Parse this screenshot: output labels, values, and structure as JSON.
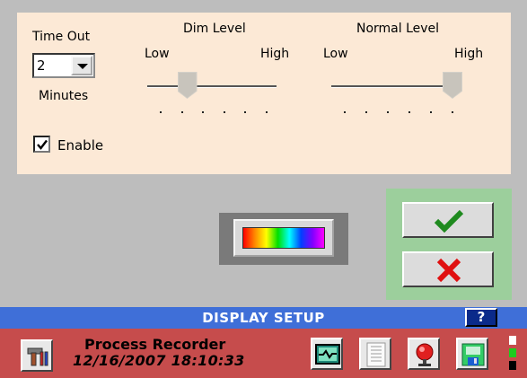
{
  "settings": {
    "timeout_label": "Time Out",
    "timeout_value": "2",
    "minutes_label": "Minutes",
    "enable_label": "Enable",
    "enable_checked": true,
    "dim_level": {
      "title": "Dim Level",
      "low": "Low",
      "high": "High",
      "ticks": 6,
      "value_fraction": 0.25
    },
    "normal_level": {
      "title": "Normal Level",
      "low": "Low",
      "high": "High",
      "ticks": 6,
      "value_fraction": 1.0
    }
  },
  "title_bar": {
    "title": "DISPLAY SETUP",
    "help_label": "?"
  },
  "status_bar": {
    "app_name": "Process Recorder",
    "datetime": "12/16/2007 18:10:33"
  },
  "icons": {
    "tools": "tools-icon",
    "chart": "chart-icon",
    "list": "list-icon",
    "alarm": "alarm-icon",
    "save": "save-icon",
    "ok": "checkmark-icon",
    "cancel": "x-icon"
  },
  "colors": {
    "panel_bg": "#fce9d6",
    "confirm_bg": "#9ccf9c",
    "title_bar": "#3f6fd8",
    "status_bar": "#c64c4c",
    "ok_green": "#1f8a1f",
    "cancel_red": "#e01010"
  },
  "indicators": [
    "white",
    "green",
    "black"
  ]
}
